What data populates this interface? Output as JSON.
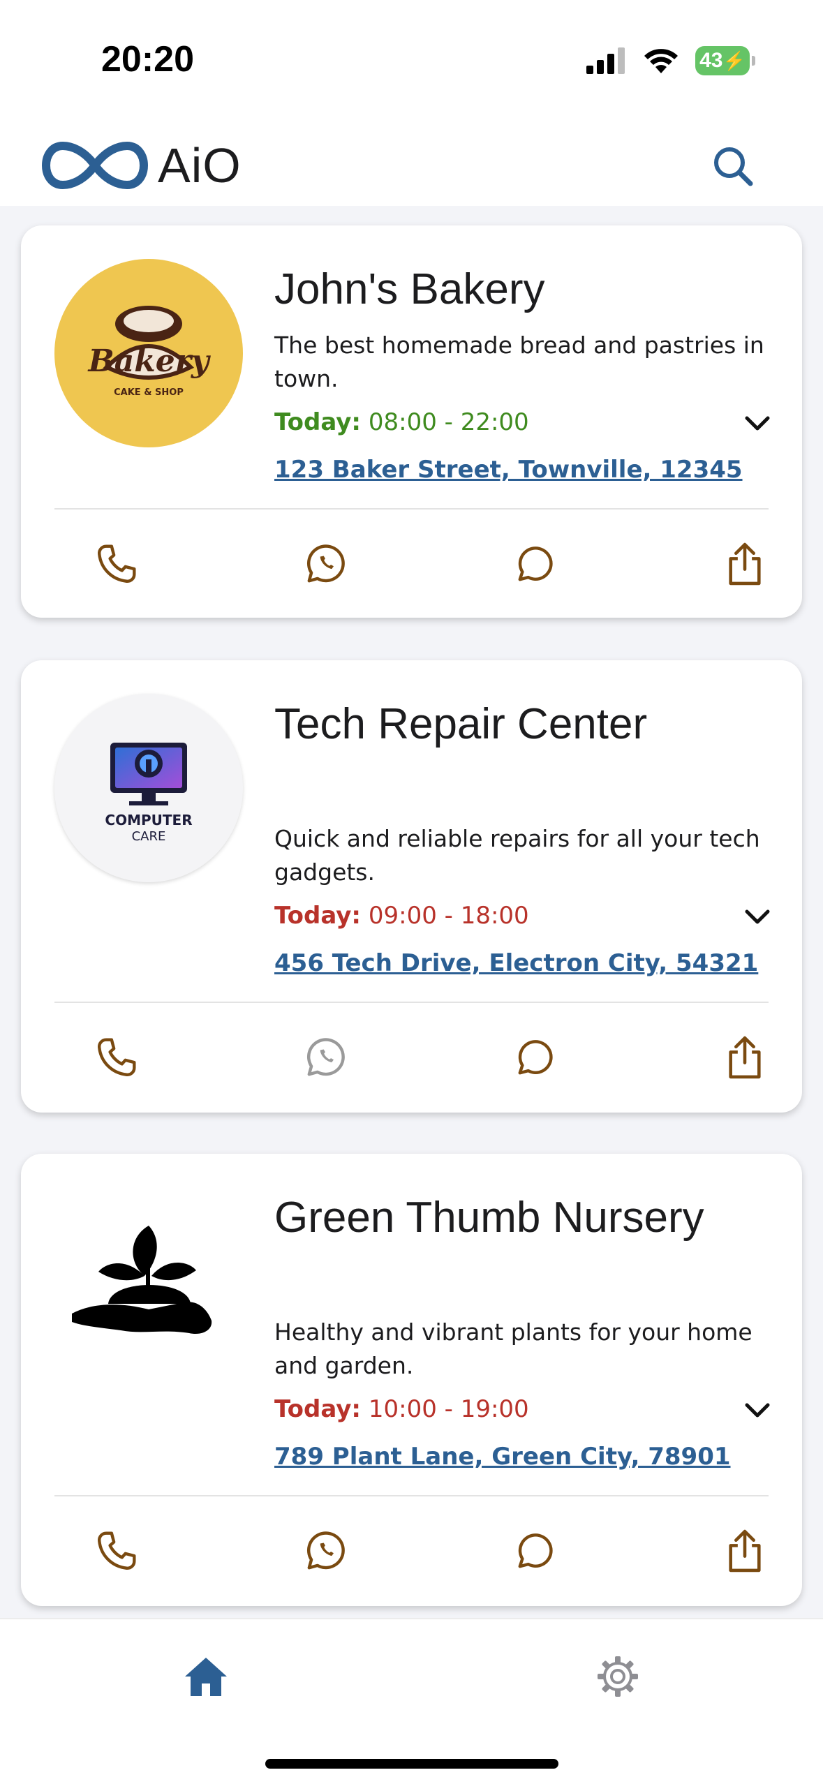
{
  "status_bar": {
    "time": "20:20",
    "battery": "43"
  },
  "header": {
    "app_name": "AiO",
    "logo_icon": "infinity-logo-icon",
    "search_icon": "search-icon"
  },
  "colors": {
    "brand": "#2c5f93",
    "action": "#7a4a10",
    "open": "#3f8b1f",
    "closed": "#b8322a",
    "disabled": "#9a9a9a"
  },
  "businesses": [
    {
      "name": "John's Bakery",
      "description": "The best homemade bread and pastries in town.",
      "hours_label": "Today:",
      "hours": "08:00 - 22:00",
      "status": "open",
      "address": "123 Baker Street, Townville, 12345",
      "logo": {
        "text_main": "Bakery",
        "text_sub": "CAKE & SHOP"
      },
      "actions": [
        "phone-icon",
        "whatsapp-icon",
        "chat-icon",
        "share-icon"
      ],
      "whatsapp_enabled": true
    },
    {
      "name": "Tech Repair Center",
      "description": "Quick and reliable repairs for all your tech gadgets.",
      "hours_label": "Today:",
      "hours": "09:00 - 18:00",
      "status": "closed",
      "address": "456 Tech Drive, Electron City, 54321",
      "logo": {
        "text_main": "COMPUTER",
        "text_sub": "CARE"
      },
      "actions": [
        "phone-icon",
        "whatsapp-icon",
        "chat-icon",
        "share-icon"
      ],
      "whatsapp_enabled": false
    },
    {
      "name": "Green Thumb Nursery",
      "description": "Healthy and vibrant plants for your home and garden.",
      "hours_label": "Today:",
      "hours": "10:00 - 19:00",
      "status": "closed",
      "address": "789 Plant Lane, Green City, 78901",
      "logo": {
        "icon": "plant-hand-icon"
      },
      "actions": [
        "phone-icon",
        "whatsapp-icon",
        "chat-icon",
        "share-icon"
      ],
      "whatsapp_enabled": true
    }
  ],
  "bottom_nav": [
    {
      "icon": "home-icon",
      "active": true
    },
    {
      "icon": "settings-gear-icon",
      "active": false
    }
  ]
}
